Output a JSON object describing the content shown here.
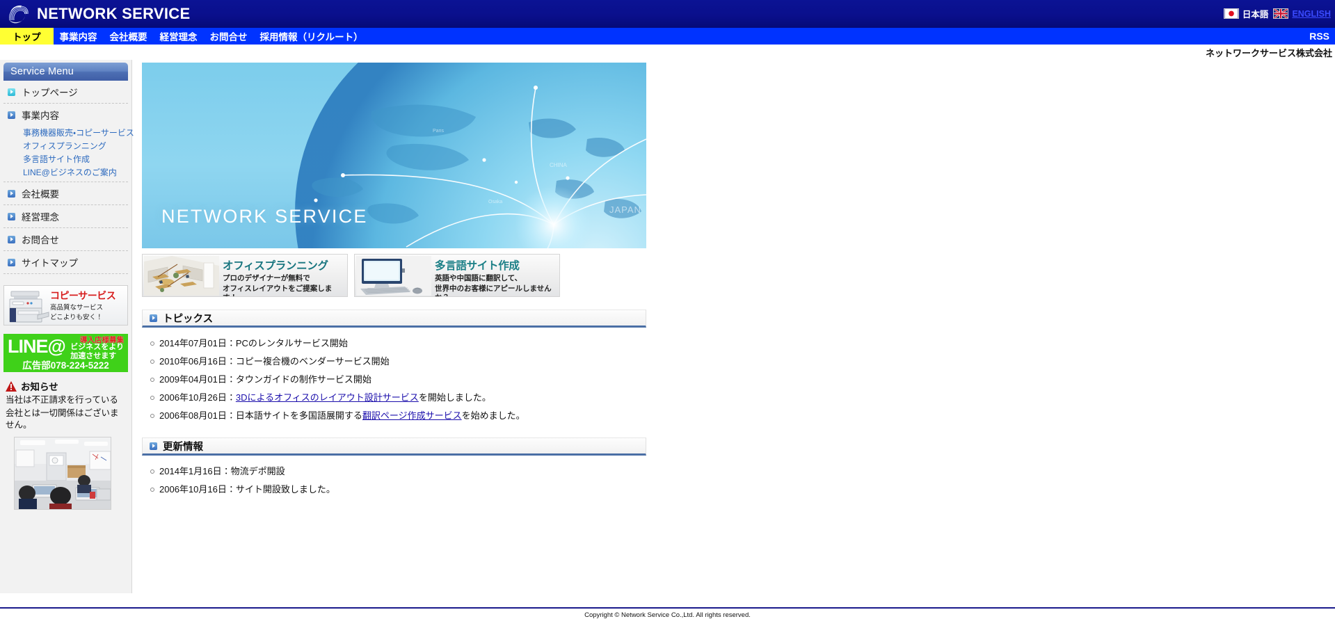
{
  "header": {
    "brand": "NETWORK SERVICE",
    "logo_icon": "swirl-logo-icon",
    "lang_ja": "日本語",
    "lang_en": "ENGLISH",
    "flag_ja_icon": "japan-flag-icon",
    "flag_en_icon": "uk-flag-icon"
  },
  "nav": {
    "items": [
      {
        "label": "トップ",
        "active": true
      },
      {
        "label": "事業内容",
        "active": false
      },
      {
        "label": "会社概要",
        "active": false
      },
      {
        "label": "経営理念",
        "active": false
      },
      {
        "label": "お問合せ",
        "active": false
      },
      {
        "label": "採用情報（リクルート）",
        "active": false
      }
    ],
    "rss": "RSS"
  },
  "company_line": "ネットワークサービス株式会社",
  "sidebar": {
    "service_menu_title": "Service Menu",
    "items": [
      {
        "label": "トップページ"
      },
      {
        "label": "事業内容"
      },
      {
        "label": "会社概要"
      },
      {
        "label": "経営理念"
      },
      {
        "label": "お問合せ"
      },
      {
        "label": "サイトマップ"
      }
    ],
    "sub_items": [
      "事務機器販売・コピーサービス",
      "オフィスプランニング",
      "多言語サイト作成",
      "LINE@ビジネスのご案内"
    ],
    "copier_banner": {
      "title": "コピーサービス",
      "line1": "高品質なサービス",
      "line2": "どこよりも安く！"
    },
    "line_banner": {
      "logo": "LINE@",
      "red_text": "導入店様募集",
      "white_line1": "ビジネスをより",
      "white_line2": "加速させます",
      "tel": "広告部078-224-5222"
    },
    "notice": {
      "icon": "warning-triangle-icon",
      "title": "お知らせ",
      "line1": "当社は不正請求を行っている",
      "line2": "会社とは一切関係はございません。"
    },
    "office_photo_alt": "office-photo"
  },
  "main": {
    "hero": {
      "title": "NETWORK SERVICE",
      "alt": "globe-network-hero-image"
    },
    "promos": [
      {
        "title": "オフィスプランニング",
        "sub1": "プロのデザイナーが無料で",
        "sub2": "オフィスレイアウトをご提案します！",
        "art": "office-layout-image"
      },
      {
        "title": "多言語サイト作成",
        "sub1": "英語や中国語に翻訳して、",
        "sub2": "世界中のお客様にアピールしませんか？",
        "art": "desktop-computer-image"
      }
    ],
    "topics": {
      "heading": "トピックス",
      "items": [
        {
          "pre": "2014年07月01日：PCのレンタルサービス開始",
          "link": "",
          "post": ""
        },
        {
          "pre": "2010年06月16日：コピー複合機のベンダーサービス開始",
          "link": "",
          "post": ""
        },
        {
          "pre": "2009年04月01日：タウンガイドの制作サービス開始",
          "link": "",
          "post": ""
        },
        {
          "pre": "2006年10月26日：",
          "link": "3Dによるオフィスのレイアウト設計サービス",
          "post": "を開始しました。"
        },
        {
          "pre": "2006年08月01日：日本語サイトを多国語展開する",
          "link": "翻訳ページ作成サービス",
          "post": "を始めました。"
        }
      ]
    },
    "updates": {
      "heading": "更新情報",
      "items": [
        {
          "pre": "2014年1月16日：物流デポ開設",
          "link": "",
          "post": ""
        },
        {
          "pre": "2006年10月16日：サイト開設致しました。",
          "link": "",
          "post": ""
        }
      ]
    }
  },
  "footer": {
    "copyright": "Copyright © Network Service Co.,Ltd. All rights reserved."
  },
  "colors": {
    "header_blue": "#0a0f8c",
    "nav_blue": "#0033ff",
    "nav_active_yellow": "#ffff33",
    "link_blue": "#1a0dab",
    "sidebar_bg": "#f2f2f2",
    "section_underline": "#4a6fa5",
    "line_green": "#3fd119",
    "copier_red": "#d61d1d",
    "promo_teal": "#18757f"
  }
}
